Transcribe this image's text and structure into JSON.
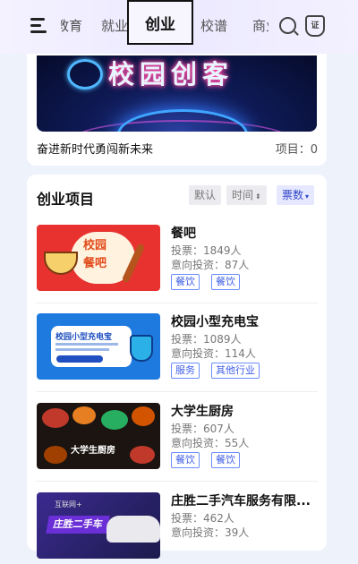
{
  "nav": {
    "tabs": [
      {
        "label": "教育",
        "active": false
      },
      {
        "label": "就业",
        "active": false
      },
      {
        "label": "创业",
        "active": true
      },
      {
        "label": "校谱",
        "active": false
      },
      {
        "label": "商业",
        "active": false
      }
    ],
    "icons": [
      "menu-icon",
      "search-icon",
      "certificate-icon"
    ],
    "certificate_glyph": "证"
  },
  "top_card": {
    "banner_title": "校园创客",
    "slogan": "奋进新时代勇闯新未来",
    "project_count": "项目：0"
  },
  "projects_section": {
    "title": "创业项目",
    "sort": [
      {
        "label": "默认",
        "active": false,
        "arrows": ""
      },
      {
        "label": "时间",
        "active": false,
        "arrows": "⬍"
      },
      {
        "label": "票数",
        "active": true,
        "arrows": "▾"
      }
    ],
    "items": [
      {
        "title": "餐吧",
        "votes": "投票：1849人",
        "intent": "意向投资：87人",
        "tags": [
          "餐饮",
          "餐饮"
        ],
        "thumb_text": [
          "校园",
          "餐吧"
        ]
      },
      {
        "title": "校园小型充电宝",
        "votes": "投票：1089人",
        "intent": "意向投资：114人",
        "tags": [
          "服务",
          "其他行业"
        ],
        "thumb_text": [
          "校园小型充电宝"
        ]
      },
      {
        "title": "大学生厨房",
        "votes": "投票：607人",
        "intent": "意向投资：55人",
        "tags": [
          "餐饮",
          "餐饮"
        ],
        "thumb_text": [
          "大学生厨房"
        ]
      },
      {
        "title": "庄胜二手汽车服务有限...",
        "votes": "投票：462人",
        "intent": "意向投资：39人",
        "tags": [],
        "thumb_text": [
          "互联网+",
          "庄胜二手车"
        ]
      }
    ]
  },
  "colors": {
    "accent": "#2f45c7",
    "tag_border": "#6b8cff",
    "background": "#eef2fb"
  }
}
